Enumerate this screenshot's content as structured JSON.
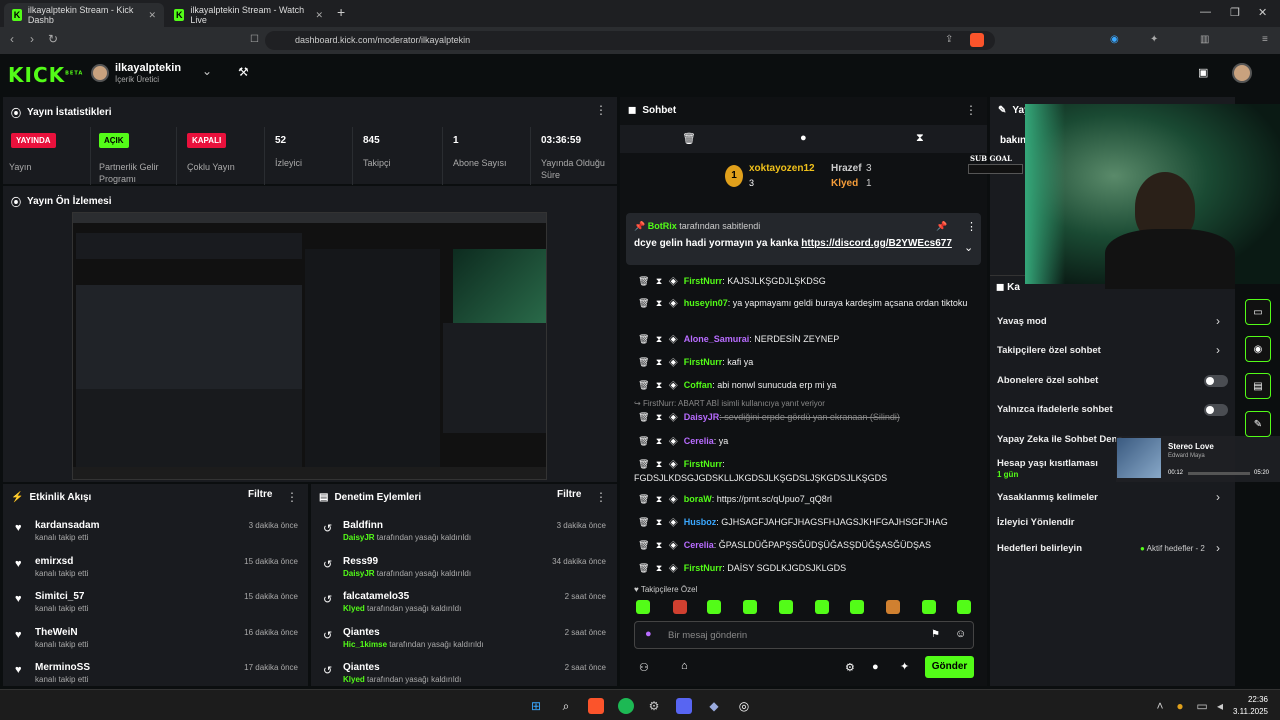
{
  "browser": {
    "tab1": "ilkayalptekin Stream - Kick Dashb",
    "tab2": "ilkayalptekin Stream - Watch Live",
    "url": "dashboard.kick.com/moderator/ilkayalptekin"
  },
  "header": {
    "logo": "KICK",
    "beta": "BETA",
    "user": "ilkayalptekin",
    "role": "İçerik Üretici"
  },
  "stats": {
    "title": "Yayın İstatistikleri",
    "items": [
      {
        "badge": "YAYINDA",
        "label": "Yayın",
        "type": "red"
      },
      {
        "badge": "AÇIK",
        "label": "Partnerlik Gelir Programı",
        "type": "green"
      },
      {
        "badge": "KAPALI",
        "label": "Çoklu Yayın",
        "type": "red"
      },
      {
        "value": "52",
        "label": "İzleyici"
      },
      {
        "value": "845",
        "label": "Takipçi"
      },
      {
        "value": "1",
        "label": "Abone Sayısı"
      },
      {
        "value": "03:36:59",
        "label": "Yayında Olduğu Süre"
      }
    ]
  },
  "preview": {
    "title": "Yayın Ön İzlemesi"
  },
  "activity": {
    "title": "Etkinlik Akışı",
    "filter": "Filtre",
    "items": [
      {
        "name": "kardansadam",
        "sub": "kanalı takip etti",
        "time": "3 dakika önce"
      },
      {
        "name": "emirxsd",
        "sub": "kanalı takip etti",
        "time": "15 dakika önce"
      },
      {
        "name": "Simitci_57",
        "sub": "kanalı takip etti",
        "time": "15 dakika önce"
      },
      {
        "name": "TheWeiN",
        "sub": "kanalı takip etti",
        "time": "16 dakika önce"
      },
      {
        "name": "MerminoSS",
        "sub": "kanalı takip etti",
        "time": "17 dakika önce"
      }
    ]
  },
  "mod": {
    "title": "Denetim Eylemleri",
    "filter": "Filtre",
    "items": [
      {
        "name": "Baldfinn",
        "by": "DaisyJR",
        "sub": " tarafından yasağı kaldırıldı",
        "time": "3 dakika önce"
      },
      {
        "name": "Ress99",
        "by": "DaisyJR",
        "sub": " tarafından yasağı kaldırıldı",
        "time": "34 dakika önce"
      },
      {
        "name": "falcatamelo35",
        "by": "Klyed",
        "sub": " tarafından yasağı kaldırıldı",
        "time": "2 saat önce"
      },
      {
        "name": "Qiantes",
        "by": "Hic_1kimse",
        "sub": " tarafından yasağı kaldırıldı",
        "time": "2 saat önce"
      },
      {
        "name": "Qiantes",
        "by": "Klyed",
        "sub": " tarafından yasağı kaldırıldı",
        "time": "2 saat önce"
      }
    ]
  },
  "chat": {
    "title": "Sohbet",
    "top1": "xoktayozen12",
    "top1n": "3",
    "top2": "Hrazef",
    "top2n": "3",
    "top3": "Klyed",
    "top3n": "1",
    "pinby": "BotRix",
    "pinby_sub": " tarafından sabitlendi",
    "pinmsg": "dcye gelin hadi yormayın ya kanka ",
    "pinlink": "https://discord.gg/B2YWEcs677",
    "lines": [
      {
        "name": "FirstNurr",
        "color": "#53fc18",
        "msg": ": KAJSJLKŞGDJLŞKDSG"
      },
      {
        "name": "huseyin07",
        "color": "#53fc18",
        "msg": ": ya    yapmayamı geldi buraya kardeşim açsana ordan tiktoku"
      },
      {
        "name": "Alone_Samurai",
        "color": "#b86cff",
        "msg": ": NERDESİN ZEYNEP"
      },
      {
        "name": "FirstNurr",
        "color": "#53fc18",
        "msg": ": kafi ya"
      },
      {
        "name": "Coffan",
        "color": "#53fc18",
        "msg": ": abi nonwl sunucuda erp mi ya"
      },
      {
        "name": "DaisyJR",
        "color": "#b86cff",
        "msg": ": sevdiğini erpde gördü yan ekranaan (Silindi)"
      },
      {
        "name": "Cerelia",
        "color": "#b86cff",
        "msg": ": ya"
      },
      {
        "name": "FirstNurr",
        "color": "#53fc18",
        "msg": ": FGDSJLKDSGJGDSKLLJKGDSJLKŞGDSLJŞKGDSJLKŞGDS"
      },
      {
        "name": "boraW",
        "color": "#53fc18",
        "msg": ": https://prnt.sc/qUpuo7_qQ8rl"
      },
      {
        "name": "Husboz",
        "color": "#3aa8ff",
        "msg": ": GJHSAGFJAHGFJHAGSFHJAGSJKHFGAJHSGFJHAG"
      },
      {
        "name": "Cerelia",
        "color": "#b86cff",
        "msg": ": ĞPASLDÜĞPAPŞSĞÜDŞÜĞASŞDÜĞŞASĞÜDŞAS"
      },
      {
        "name": "FirstNurr",
        "color": "#53fc18",
        "msg": ": DAİSY SGDLKJGDSJKLGDS"
      }
    ],
    "reply": "FirstNurr: ABART ABİ isimli kullanıcıya yanıt veriyor",
    "followers": "Takipçilere Özel",
    "placeholder": "Bir mesaj gönderin",
    "send": "Gönder"
  },
  "settings": {
    "title": "Yayı",
    "sub": "bakın",
    "title2": "Ka",
    "items": [
      "Yavaş mod",
      "Takipçilere özel sohbet",
      "Abonelere özel sohbet",
      "Yalnızca ifadelerle sohbet",
      "Yapay Zeka ile Sohbet Dene",
      "Hesap yaşı kısıtlaması",
      "Yasaklanmış kelimeler",
      "İzleyici Yönlendir",
      "Hedefleri belirleyin"
    ],
    "agelimit": "1 gün",
    "goals": "Aktif hedefler - 2"
  },
  "overlay": {
    "subgoal": "SUB GOAL",
    "song": "Stereo Love",
    "artist": "Edward Maya",
    "t1": "00:12",
    "t2": "05:20"
  },
  "taskbar": {
    "time": "22:36",
    "date": "3.11.2025"
  }
}
